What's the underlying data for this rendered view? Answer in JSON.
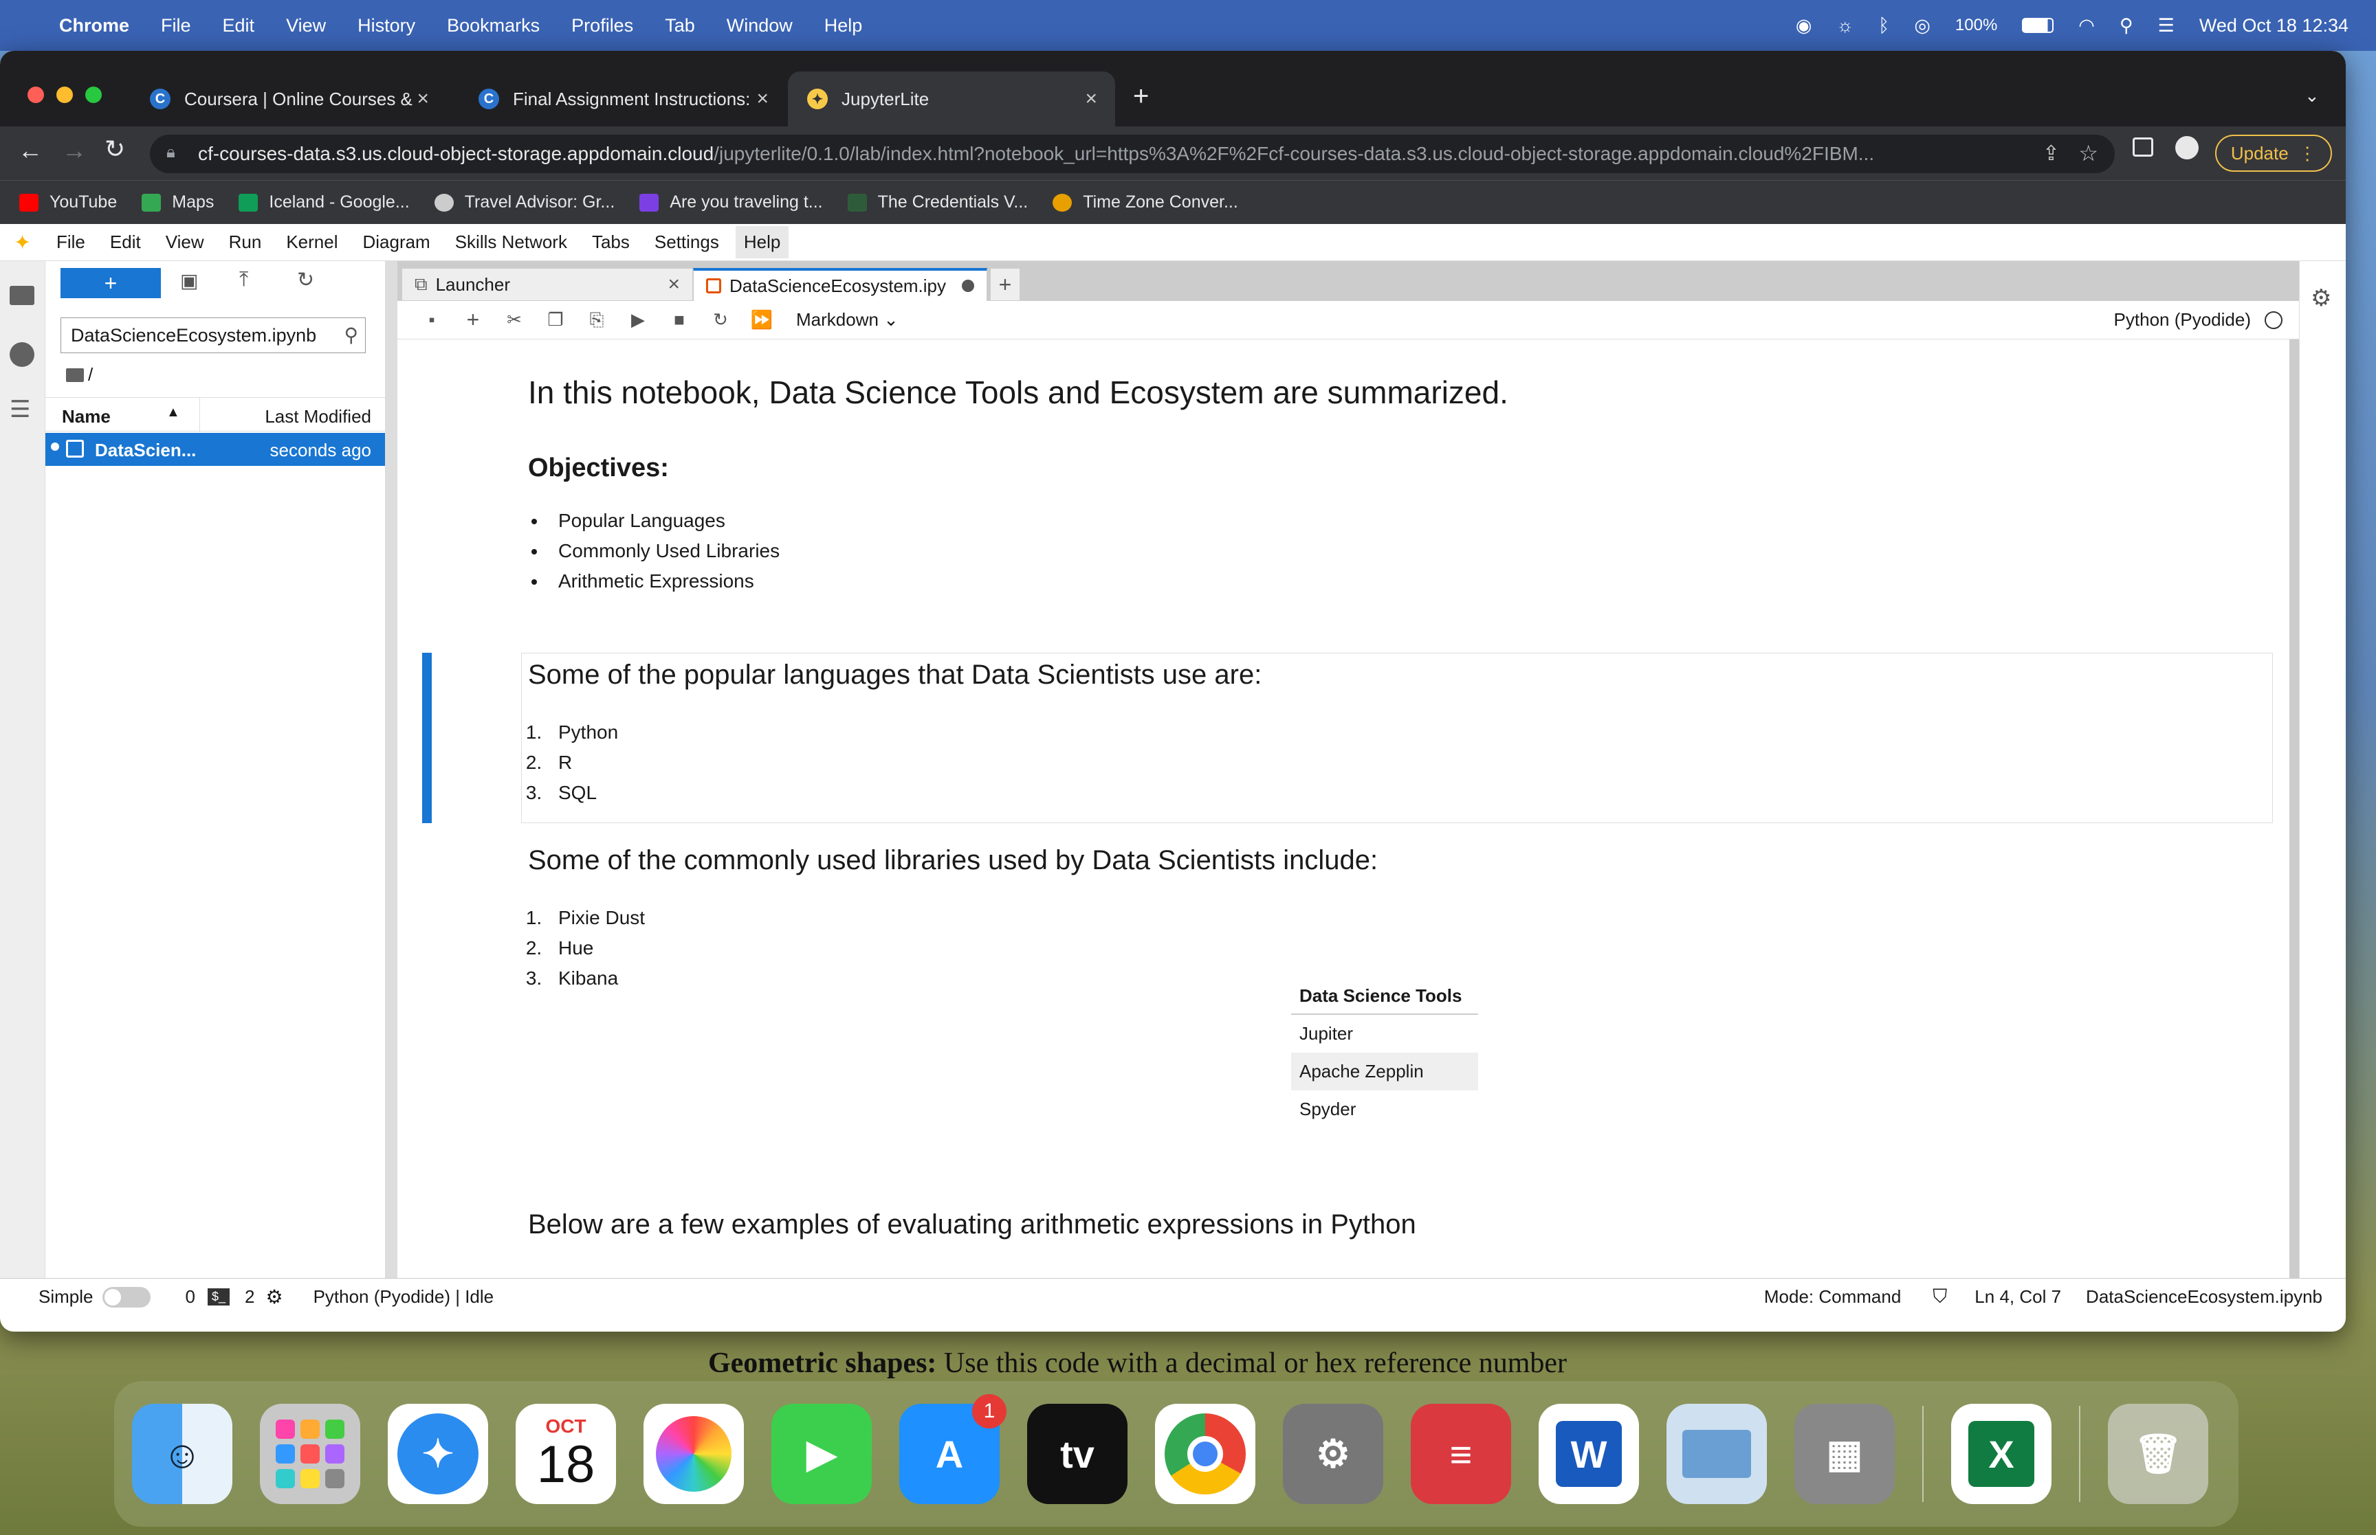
{
  "menubar": {
    "items": [
      "Chrome",
      "File",
      "Edit",
      "View",
      "History",
      "Bookmarks",
      "Profiles",
      "Tab",
      "Window",
      "Help"
    ],
    "battery": "100%",
    "datetime": "Wed Oct 18  12:34"
  },
  "browser": {
    "tabs": [
      {
        "title": "Coursera | Online Courses & C",
        "icon": "coursera-icon"
      },
      {
        "title": "Final Assignment Instructions:",
        "icon": "coursera-icon"
      },
      {
        "title": "JupyterLite",
        "icon": "jupyter-icon"
      }
    ],
    "url_host": "cf-courses-data.s3.us.cloud-object-storage.appdomain.cloud",
    "url_path": "/jupyterlite/0.1.0/lab/index.html?notebook_url=https%3A%2F%2Fcf-courses-data.s3.us.cloud-object-storage.appdomain.cloud%2FIBM...",
    "update_label": "Update",
    "bookmarks": [
      {
        "label": "YouTube",
        "color": "#ff0000"
      },
      {
        "label": "Maps",
        "color": "#34a853"
      },
      {
        "label": "Iceland - Google...",
        "color": "#0f9d58"
      },
      {
        "label": "Travel Advisor: Gr...",
        "color": "#cccccc"
      },
      {
        "label": "Are you traveling t...",
        "color": "#7b3fe4"
      },
      {
        "label": "The Credentials V...",
        "color": "#2e5c3a"
      },
      {
        "label": "Time Zone Conver...",
        "color": "#e8a000"
      }
    ]
  },
  "jupyter": {
    "menu": [
      "File",
      "Edit",
      "View",
      "Run",
      "Kernel",
      "Diagram",
      "Skills Network",
      "Tabs",
      "Settings",
      "Help"
    ],
    "new_label": "+",
    "file_filter": "DataScienceEcosystem.ipynb",
    "breadcrumb": "/",
    "columns": {
      "name": "Name",
      "modified": "Last Modified"
    },
    "files": [
      {
        "name": "DataScien...",
        "modified": "seconds ago"
      }
    ],
    "tabs": [
      {
        "label": "Launcher"
      },
      {
        "label": "DataScienceEcosystem.ipy"
      }
    ],
    "cell_type": "Markdown",
    "kernel": "Python (Pyodide)",
    "notebook": {
      "title": "In this notebook, Data Science Tools and Ecosystem are summarized.",
      "objectives_heading": "Objectives:",
      "objectives": [
        "Popular Languages",
        "Commonly Used Libraries",
        "Arithmetic Expressions"
      ],
      "languages_heading": "Some of the popular languages that Data Scientists use are:",
      "languages": [
        "Python",
        "R",
        "SQL"
      ],
      "libraries_heading": "Some of the commonly used libraries used by Data Scientists include:",
      "libraries": [
        "Pixie Dust",
        "Hue",
        "Kibana"
      ],
      "tools_header": "Data Science Tools",
      "tools": [
        "Jupiter",
        "Apache Zepplin",
        "Spyder"
      ],
      "arith_heading": "Below are a few examples of evaluating arithmetic expressions in Python"
    },
    "status": {
      "simple": "Simple",
      "terminals": "0",
      "kernels": "2",
      "kernel_status": "Python (Pyodide) | Idle",
      "mode": "Mode: Command",
      "position": "Ln 4, Col 7",
      "filename": "DataScienceEcosystem.ipynb"
    }
  },
  "background_caption": {
    "bold": "Geometric shapes:",
    "text": " Use this code with a decimal or hex reference number"
  },
  "dock": {
    "calendar_month": "OCT",
    "calendar_day": "18",
    "appstore_badge": "1",
    "tv_label": "tv",
    "apps": [
      "finder",
      "launchpad",
      "safari",
      "calendar",
      "photos",
      "facetime",
      "app-store",
      "apple-tv",
      "chrome",
      "system-settings",
      "expressvpn",
      "word",
      "preview",
      "calculator",
      "excel",
      "trash"
    ]
  }
}
